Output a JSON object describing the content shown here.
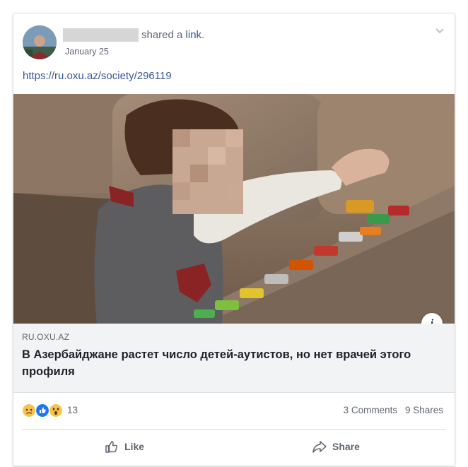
{
  "post": {
    "shared_prefix": "shared a ",
    "shared_link_word": "link",
    "shared_suffix": ".",
    "date": "January 25",
    "url": "https://ru.oxu.az/society/296119"
  },
  "link_preview": {
    "domain": "RU.OXU.AZ",
    "headline": "В Азербайджане растет число детей-аутистов, но нет врачей этого профиля",
    "info_glyph": "i"
  },
  "engagement": {
    "reaction_icons": [
      "sad-reaction-icon",
      "like-reaction-icon",
      "wow-reaction-icon"
    ],
    "reaction_count": "13",
    "comments": "3 Comments",
    "shares": "9 Shares"
  },
  "actions": {
    "like_label": "Like",
    "share_label": "Share"
  },
  "colors": {
    "link_blue": "#385898",
    "text_gray": "#606770",
    "like_blue": "#1877f2",
    "reaction_yellow": "#f7c34d"
  }
}
